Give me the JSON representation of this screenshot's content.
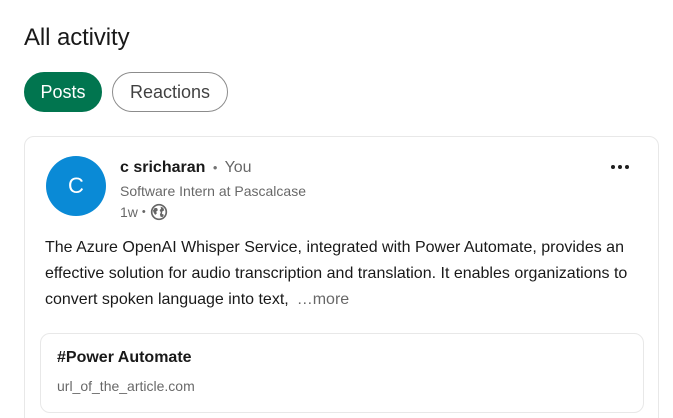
{
  "page": {
    "title": "All activity"
  },
  "filters": {
    "posts": "Posts",
    "reactions": "Reactions"
  },
  "post": {
    "avatar_initial": "C",
    "author_name": "c sricharan",
    "separator": "•",
    "author_label": "You",
    "headline": "Software Intern at Pascalcase",
    "time": "1w",
    "meta_separator": "•",
    "visibility_icon": "globe-icon",
    "more_icon": "more-options-icon",
    "body": "The Azure OpenAI Whisper Service, integrated with Power Automate, provides an effective solution for audio transcription and translation. It enables organizations to convert spoken language into text,",
    "see_more": "…more",
    "article": {
      "title": "#Power Automate",
      "url": "url_of_the_article.com"
    }
  },
  "colors": {
    "accent_green": "#01754f",
    "avatar_blue": "#0a8ad6"
  }
}
